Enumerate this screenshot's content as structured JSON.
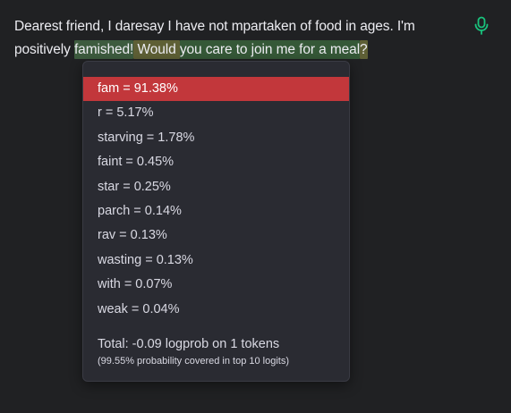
{
  "prompt": {
    "segments": [
      {
        "text": "Dearest friend, I daresay I have not mpartaken of food in ages. I'm positively ",
        "highlight": "none"
      },
      {
        "text": "famished!",
        "highlight": "green"
      },
      {
        "text": " Would ",
        "highlight": "olive"
      },
      {
        "text": "you care to join me for a meal",
        "highlight": "dark-green"
      },
      {
        "text": "?",
        "highlight": "olive"
      }
    ]
  },
  "mic": {
    "icon": "microphone-icon",
    "color": "#19c37d"
  },
  "popup": {
    "logits": [
      {
        "label": "fam = 91.38%",
        "selected": true
      },
      {
        "label": "r = 5.17%",
        "selected": false
      },
      {
        "label": "starving = 1.78%",
        "selected": false
      },
      {
        "label": "faint = 0.45%",
        "selected": false
      },
      {
        "label": "star = 0.25%",
        "selected": false
      },
      {
        "label": "parch = 0.14%",
        "selected": false
      },
      {
        "label": "rav = 0.13%",
        "selected": false
      },
      {
        "label": "wasting = 0.13%",
        "selected": false
      },
      {
        "label": "with = 0.07%",
        "selected": false
      },
      {
        "label": "weak = 0.04%",
        "selected": false
      }
    ],
    "total": "Total: -0.09 logprob on 1 tokens",
    "coverage": "(99.55% probability covered in top 10 logits)"
  },
  "colors": {
    "background": "#202123",
    "popup_background": "#2a2b32",
    "selected_row": "#c2373b",
    "highlight_green": "#3d5b3e",
    "highlight_olive": "#5e5f35"
  }
}
